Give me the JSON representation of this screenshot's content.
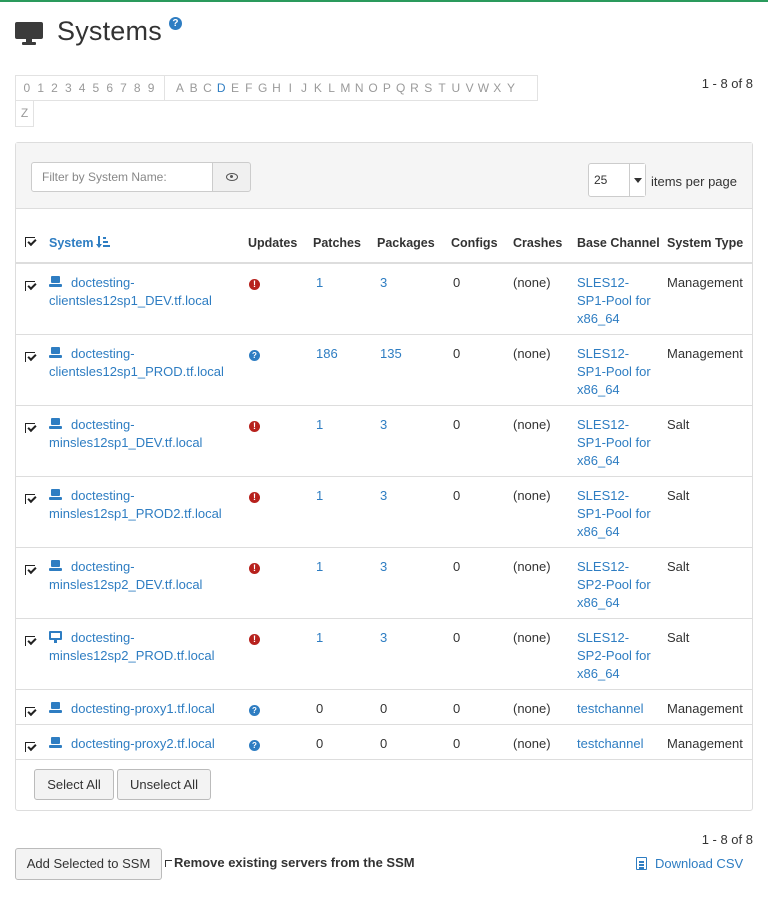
{
  "page": {
    "title": "Systems",
    "help_badge": "?"
  },
  "alphabar": {
    "digits": [
      "0",
      "1",
      "2",
      "3",
      "4",
      "5",
      "6",
      "7",
      "8",
      "9"
    ],
    "letters": [
      "A",
      "B",
      "C",
      "D",
      "E",
      "F",
      "G",
      "H",
      "I",
      "J",
      "K",
      "L",
      "M",
      "N",
      "O",
      "P",
      "Q",
      "R",
      "S",
      "T",
      "U",
      "V",
      "W",
      "X",
      "Y"
    ],
    "overflow_letter": "Z",
    "active": "D"
  },
  "pagination": {
    "range": "1 - 8 of 8"
  },
  "filter": {
    "placeholder": "Filter by System Name:"
  },
  "items_per_page": {
    "value": "25",
    "label": "items per page"
  },
  "columns": {
    "system": "System",
    "updates": "Updates",
    "patches": "Patches",
    "packages": "Packages",
    "configs": "Configs",
    "crashes": "Crashes",
    "base_channel": "Base Channel",
    "system_type": "System Type"
  },
  "rows": [
    {
      "icon": "server-icon",
      "name": "doctesting-clientsles12sp1_DEV.tf.local",
      "update_status": "critical",
      "patches": "1",
      "packages": "3",
      "configs": "0",
      "crashes": "(none)",
      "channel": "SLES12-SP1-Pool for x86_64",
      "type": "Management"
    },
    {
      "icon": "server-icon",
      "name": "doctesting-clientsles12sp1_PROD.tf.local",
      "update_status": "unknown",
      "patches": "186",
      "packages": "135",
      "configs": "0",
      "crashes": "(none)",
      "channel": "SLES12-SP1-Pool for x86_64",
      "type": "Management"
    },
    {
      "icon": "server-icon",
      "name": "doctesting-minsles12sp1_DEV.tf.local",
      "update_status": "critical",
      "patches": "1",
      "packages": "3",
      "configs": "0",
      "crashes": "(none)",
      "channel": "SLES12-SP1-Pool for x86_64",
      "type": "Salt"
    },
    {
      "icon": "server-icon",
      "name": "doctesting-minsles12sp1_PROD2.tf.local",
      "update_status": "critical",
      "patches": "1",
      "packages": "3",
      "configs": "0",
      "crashes": "(none)",
      "channel": "SLES12-SP1-Pool for x86_64",
      "type": "Salt"
    },
    {
      "icon": "server-icon",
      "name": "doctesting-minsles12sp2_DEV.tf.local",
      "update_status": "critical",
      "patches": "1",
      "packages": "3",
      "configs": "0",
      "crashes": "(none)",
      "channel": "SLES12-SP2-Pool for x86_64",
      "type": "Salt"
    },
    {
      "icon": "desktop-icon",
      "name": "doctesting-minsles12sp2_PROD.tf.local",
      "update_status": "critical",
      "patches": "1",
      "packages": "3",
      "configs": "0",
      "crashes": "(none)",
      "channel": "SLES12-SP2-Pool for x86_64",
      "type": "Salt"
    },
    {
      "icon": "server-icon",
      "name": "doctesting-proxy1.tf.local",
      "update_status": "unknown",
      "patches": "0",
      "packages": "0",
      "configs": "0",
      "crashes": "(none)",
      "channel": "testchannel",
      "type": "Management"
    },
    {
      "icon": "server-icon",
      "name": "doctesting-proxy2.tf.local",
      "update_status": "unknown",
      "patches": "0",
      "packages": "0",
      "configs": "0",
      "crashes": "(none)",
      "channel": "testchannel",
      "type": "Management"
    }
  ],
  "buttons": {
    "select_all": "Select All",
    "unselect_all": "Unselect All",
    "add_to_ssm": "Add Selected to SSM",
    "remove_existing": "Remove existing servers from the SSM",
    "download_csv": "Download CSV"
  },
  "colors": {
    "accent": "#2e7dc2",
    "critical": "#b7211d",
    "topbar": "#2a9a5c"
  }
}
